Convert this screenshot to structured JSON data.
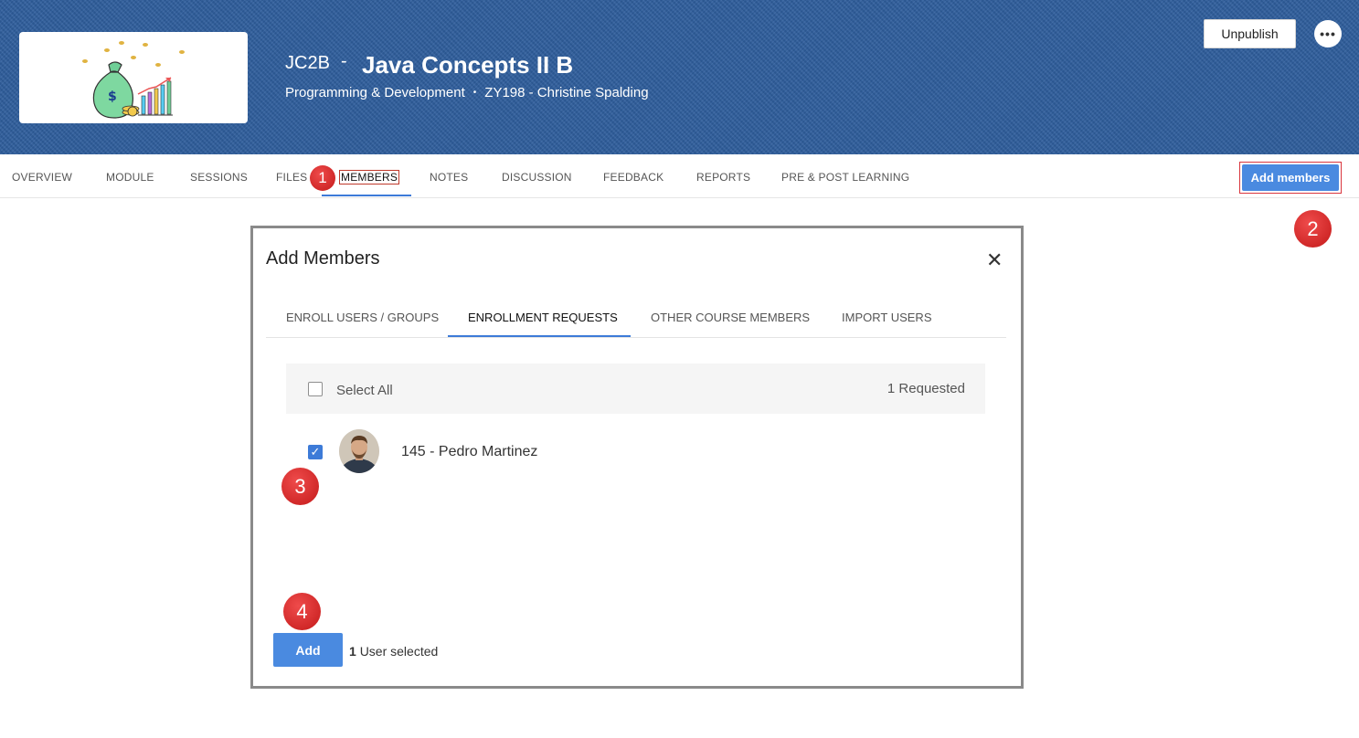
{
  "header": {
    "course_code": "JC2B",
    "separator": "-",
    "course_title": "Java Concepts II B",
    "category": "Programming & Development",
    "bullet": "•",
    "instructor": "ZY198 - Christine Spalding",
    "unpublish_label": "Unpublish",
    "more_label": "•••",
    "banner_color": "#2f5f9e"
  },
  "nav": {
    "items": [
      {
        "label": "OVERVIEW"
      },
      {
        "label": "MODULE"
      },
      {
        "label": "SESSIONS"
      },
      {
        "label": "FILES"
      },
      {
        "label": "MEMBERS"
      },
      {
        "label": "NOTES"
      },
      {
        "label": "DISCUSSION"
      },
      {
        "label": "FEEDBACK"
      },
      {
        "label": "REPORTS"
      },
      {
        "label": "PRE & POST LEARNING"
      }
    ],
    "active": "MEMBERS",
    "add_members_label": "Add members",
    "accent_color": "#4a8ae0"
  },
  "markers": [
    "1",
    "2",
    "3",
    "4"
  ],
  "modal": {
    "title": "Add Members",
    "close_glyph": "✕",
    "tabs": [
      {
        "label": "ENROLL USERS / GROUPS"
      },
      {
        "label": "ENROLLMENT REQUESTS"
      },
      {
        "label": "OTHER COURSE MEMBERS"
      },
      {
        "label": "IMPORT USERS"
      }
    ],
    "active_tab": "ENROLLMENT REQUESTS",
    "select_all_label": "Select All",
    "requested_text": "1 Requested",
    "members": [
      {
        "name": "145 - Pedro Martinez",
        "checked": true
      }
    ],
    "add_label": "Add",
    "selected_count": "1",
    "selected_suffix": "User selected"
  }
}
